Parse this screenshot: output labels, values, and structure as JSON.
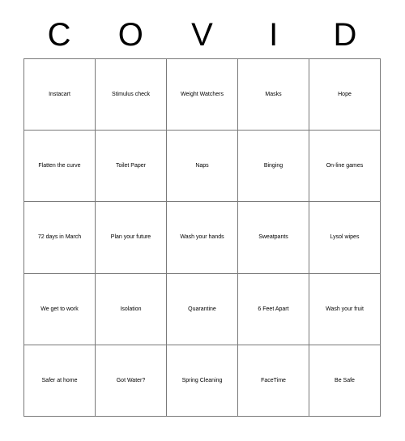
{
  "card": {
    "title_letters": [
      "C",
      "O",
      "V",
      "I",
      "D"
    ],
    "grid_columns": 5,
    "grid_rows": 5,
    "border_color": "#7a7a7a",
    "text_color": "#000000",
    "background_color": "#ffffff",
    "rows": [
      [
        {
          "text": "Instacart",
          "size": "md"
        },
        {
          "text": "Stimulus check",
          "size": "sm"
        },
        {
          "text": "Weight Watchers",
          "size": "xs"
        },
        {
          "text": "Masks",
          "size": "lg"
        },
        {
          "text": "Hope",
          "size": "xl"
        }
      ],
      [
        {
          "text": "Flatten the curve",
          "size": "sm"
        },
        {
          "text": "Toilet Paper",
          "size": "lg"
        },
        {
          "text": "Naps",
          "size": "xl"
        },
        {
          "text": "Binging",
          "size": "md"
        },
        {
          "text": "On-line games",
          "size": "sm"
        }
      ],
      [
        {
          "text": "72 days in March",
          "size": "sm"
        },
        {
          "text": "Plan your future",
          "size": "sm"
        },
        {
          "text": "Wash your hands",
          "size": "sm"
        },
        {
          "text": "Sweatpants",
          "size": "xxs"
        },
        {
          "text": "Lysol wipes",
          "size": "lg"
        }
      ],
      [
        {
          "text": "We get to work",
          "size": "md"
        },
        {
          "text": "Isolation",
          "size": "sm"
        },
        {
          "text": "Quarantine",
          "size": "xxs"
        },
        {
          "text": "6 Feet Apart",
          "size": "md"
        },
        {
          "text": "Wash your fruit",
          "size": "xs"
        }
      ],
      [
        {
          "text": "Safer at home",
          "size": "sm"
        },
        {
          "text": "Got Water?",
          "size": "md"
        },
        {
          "text": "Spring Cleaning",
          "size": "xs"
        },
        {
          "text": "FaceTime",
          "size": "xs"
        },
        {
          "text": "Be Safe",
          "size": "xl"
        }
      ]
    ]
  }
}
